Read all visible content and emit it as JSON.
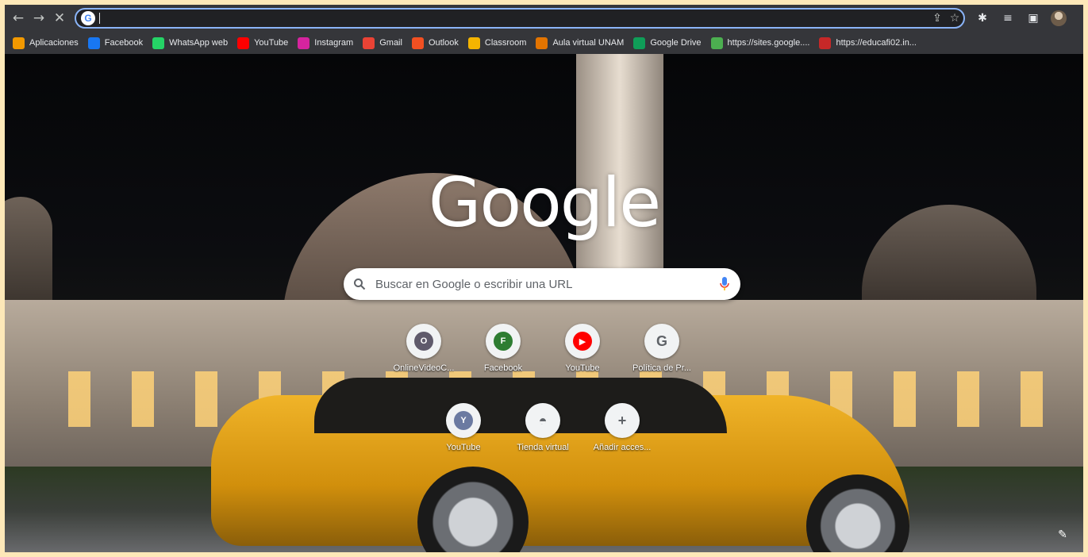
{
  "toolbar": {
    "back_icon": "←",
    "forward_icon": "→",
    "stop_icon": "✕",
    "omnibox_value": "",
    "share_icon": "⇪",
    "star_icon": "☆",
    "extensions_icon": "✱",
    "reading_list_icon": "≡",
    "side_panel_icon": "▣",
    "menu_icon": "⋮"
  },
  "bookmarks": [
    {
      "label": "Aplicaciones",
      "icon": "apps-grid-icon",
      "color": "#f29900"
    },
    {
      "label": "Facebook",
      "icon": "facebook-icon",
      "color": "#1877f2"
    },
    {
      "label": "WhatsApp web",
      "icon": "whatsapp-icon",
      "color": "#25d366"
    },
    {
      "label": "YouTube",
      "icon": "youtube-icon",
      "color": "#ff0000"
    },
    {
      "label": "Instagram",
      "icon": "instagram-icon",
      "color": "#d6249f"
    },
    {
      "label": "Gmail",
      "icon": "gmail-icon",
      "color": "#ea4335"
    },
    {
      "label": "Outlook",
      "icon": "outlook-icon",
      "color": "#f25022"
    },
    {
      "label": "Classroom",
      "icon": "classroom-icon",
      "color": "#f4b400"
    },
    {
      "label": "Aula virtual UNAM",
      "icon": "aula-virtual-icon",
      "color": "#e37400"
    },
    {
      "label": "Google Drive",
      "icon": "google-drive-icon",
      "color": "#0f9d58"
    },
    {
      "label": "https://sites.google....",
      "icon": "sites-icon",
      "color": "#4caf50"
    },
    {
      "label": "https://educafi02.in...",
      "icon": "educafi-icon",
      "color": "#c62828"
    }
  ],
  "ntp": {
    "logo_text": "Google",
    "search_placeholder": "Buscar en Google o escribir una URL",
    "shortcuts_row1": [
      {
        "label": "OnlineVideoC...",
        "letter": "O",
        "color": "#5f5a6b"
      },
      {
        "label": "Facebook",
        "letter": "F",
        "color": "#2e7d32"
      },
      {
        "label": "YouTube",
        "letter": "▶",
        "color": "#ff0000"
      },
      {
        "label": "Política de Pr...",
        "letter": "G",
        "color": "#ffffff"
      }
    ],
    "shortcuts_row2": [
      {
        "label": "YouTube",
        "letter": "Y",
        "color": "#6b7aa1"
      },
      {
        "label": "Tienda virtual",
        "letter": "◓",
        "color": "#ffffff"
      },
      {
        "label": "Añadir acces...",
        "letter": "+",
        "color": "#ffffff"
      }
    ],
    "edit_icon": "✎"
  },
  "colors": {
    "toolbar_bg": "#35363a",
    "omnibox_border": "#8ab4f8",
    "page_outer_bg": "#fde8b8"
  }
}
